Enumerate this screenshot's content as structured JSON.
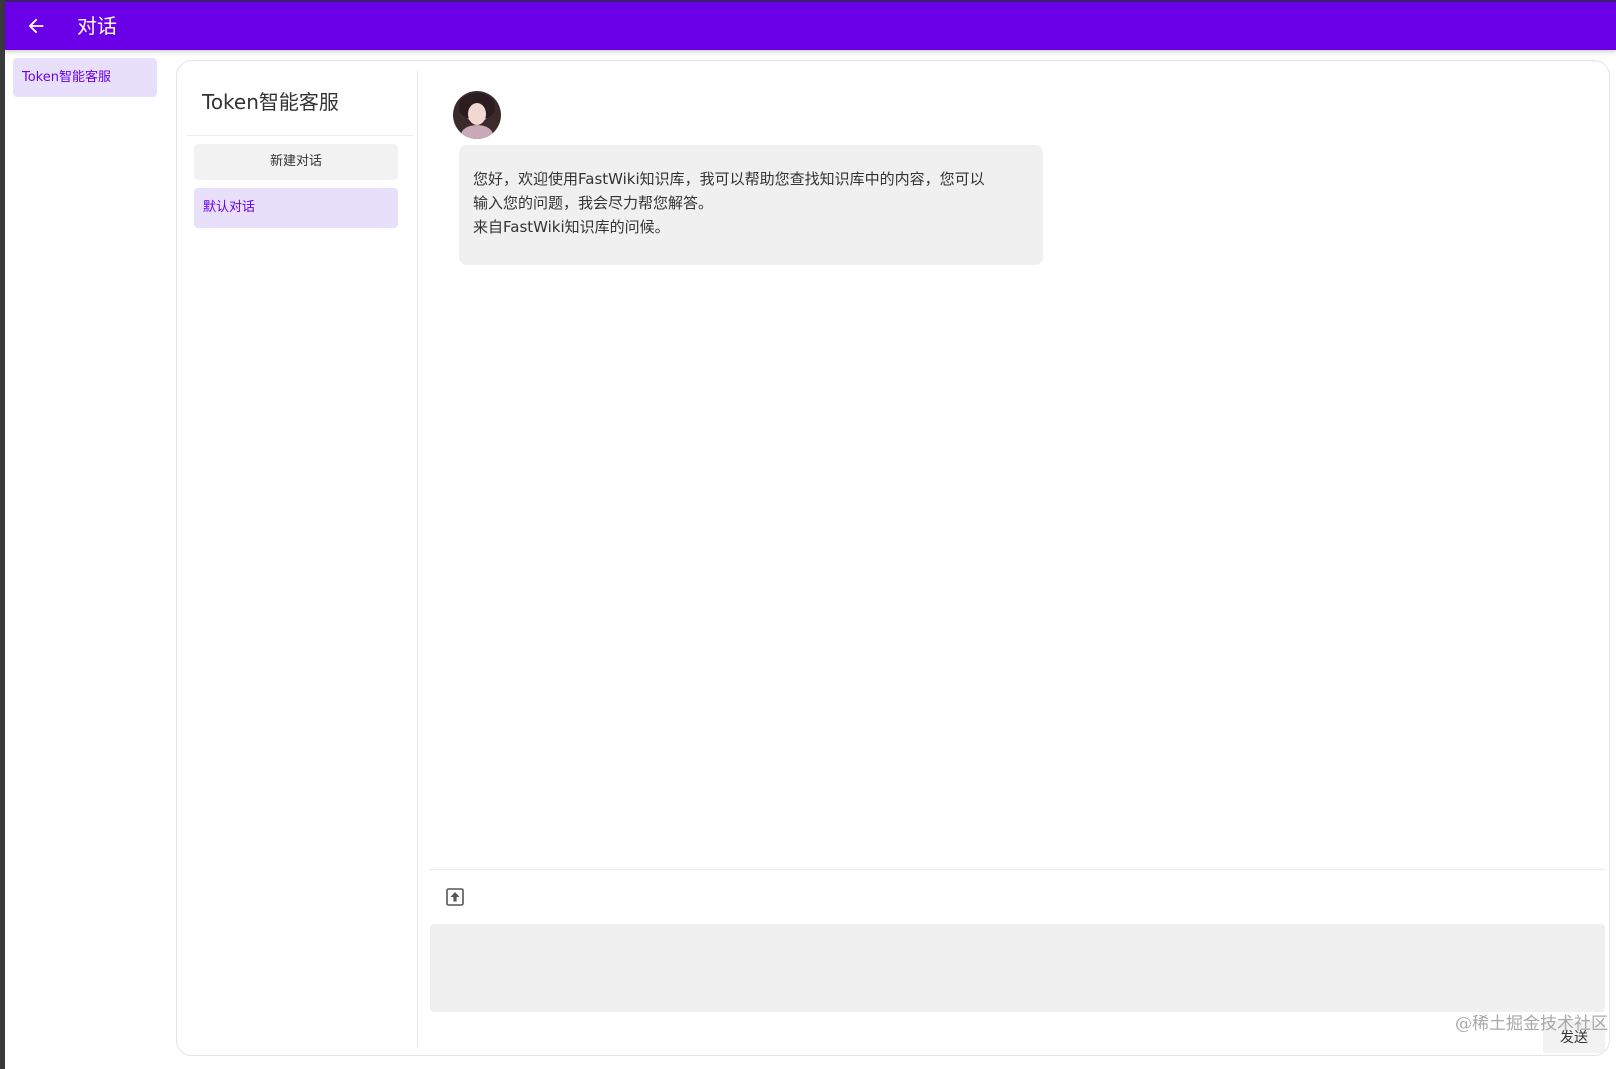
{
  "appbar": {
    "title": "对话",
    "back_icon": "arrow-left-icon",
    "color": "#6a00e8"
  },
  "nav": {
    "items": [
      {
        "label": "Token智能客服",
        "selected": true
      }
    ]
  },
  "side_panel": {
    "app_name": "Token智能客服",
    "new_chat_label": "新建对话",
    "conversations": [
      {
        "label": "默认对话",
        "selected": true
      }
    ]
  },
  "chat": {
    "messages": [
      {
        "role": "assistant",
        "avatar": "assistant-avatar",
        "lines": [
          "您好，欢迎使用FastWiki知识库，我可以帮助您查找知识库中的内容，您可以",
          "输入您的问题，我会尽力帮您解答。",
          "来自FastWiki知识库的问候。"
        ]
      }
    ],
    "upload_icon": "upload-icon",
    "input_value": "",
    "send_label": "发送"
  },
  "watermark": "@稀土掘金技术社区",
  "colors": {
    "accent": "#6a00e8",
    "selected_bg": "#e8e0fb",
    "bubble_bg": "#f0f0f0"
  }
}
